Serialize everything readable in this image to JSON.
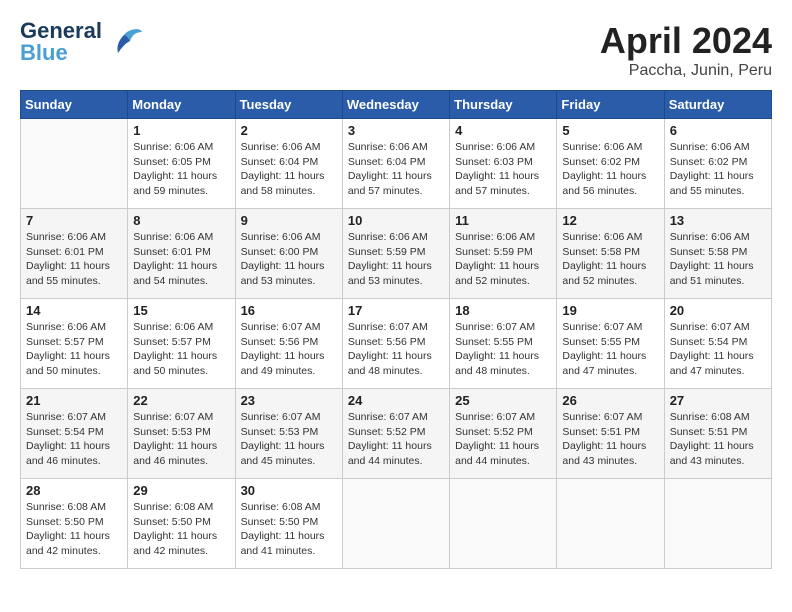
{
  "header": {
    "logo_line1": "General",
    "logo_line2": "Blue",
    "month": "April 2024",
    "location": "Paccha, Junin, Peru"
  },
  "days_of_week": [
    "Sunday",
    "Monday",
    "Tuesday",
    "Wednesday",
    "Thursday",
    "Friday",
    "Saturday"
  ],
  "weeks": [
    [
      {
        "day": "",
        "info": ""
      },
      {
        "day": "1",
        "info": "Sunrise: 6:06 AM\nSunset: 6:05 PM\nDaylight: 11 hours\nand 59 minutes."
      },
      {
        "day": "2",
        "info": "Sunrise: 6:06 AM\nSunset: 6:04 PM\nDaylight: 11 hours\nand 58 minutes."
      },
      {
        "day": "3",
        "info": "Sunrise: 6:06 AM\nSunset: 6:04 PM\nDaylight: 11 hours\nand 57 minutes."
      },
      {
        "day": "4",
        "info": "Sunrise: 6:06 AM\nSunset: 6:03 PM\nDaylight: 11 hours\nand 57 minutes."
      },
      {
        "day": "5",
        "info": "Sunrise: 6:06 AM\nSunset: 6:02 PM\nDaylight: 11 hours\nand 56 minutes."
      },
      {
        "day": "6",
        "info": "Sunrise: 6:06 AM\nSunset: 6:02 PM\nDaylight: 11 hours\nand 55 minutes."
      }
    ],
    [
      {
        "day": "7",
        "info": "Sunrise: 6:06 AM\nSunset: 6:01 PM\nDaylight: 11 hours\nand 55 minutes."
      },
      {
        "day": "8",
        "info": "Sunrise: 6:06 AM\nSunset: 6:01 PM\nDaylight: 11 hours\nand 54 minutes."
      },
      {
        "day": "9",
        "info": "Sunrise: 6:06 AM\nSunset: 6:00 PM\nDaylight: 11 hours\nand 53 minutes."
      },
      {
        "day": "10",
        "info": "Sunrise: 6:06 AM\nSunset: 5:59 PM\nDaylight: 11 hours\nand 53 minutes."
      },
      {
        "day": "11",
        "info": "Sunrise: 6:06 AM\nSunset: 5:59 PM\nDaylight: 11 hours\nand 52 minutes."
      },
      {
        "day": "12",
        "info": "Sunrise: 6:06 AM\nSunset: 5:58 PM\nDaylight: 11 hours\nand 52 minutes."
      },
      {
        "day": "13",
        "info": "Sunrise: 6:06 AM\nSunset: 5:58 PM\nDaylight: 11 hours\nand 51 minutes."
      }
    ],
    [
      {
        "day": "14",
        "info": "Sunrise: 6:06 AM\nSunset: 5:57 PM\nDaylight: 11 hours\nand 50 minutes."
      },
      {
        "day": "15",
        "info": "Sunrise: 6:06 AM\nSunset: 5:57 PM\nDaylight: 11 hours\nand 50 minutes."
      },
      {
        "day": "16",
        "info": "Sunrise: 6:07 AM\nSunset: 5:56 PM\nDaylight: 11 hours\nand 49 minutes."
      },
      {
        "day": "17",
        "info": "Sunrise: 6:07 AM\nSunset: 5:56 PM\nDaylight: 11 hours\nand 48 minutes."
      },
      {
        "day": "18",
        "info": "Sunrise: 6:07 AM\nSunset: 5:55 PM\nDaylight: 11 hours\nand 48 minutes."
      },
      {
        "day": "19",
        "info": "Sunrise: 6:07 AM\nSunset: 5:55 PM\nDaylight: 11 hours\nand 47 minutes."
      },
      {
        "day": "20",
        "info": "Sunrise: 6:07 AM\nSunset: 5:54 PM\nDaylight: 11 hours\nand 47 minutes."
      }
    ],
    [
      {
        "day": "21",
        "info": "Sunrise: 6:07 AM\nSunset: 5:54 PM\nDaylight: 11 hours\nand 46 minutes."
      },
      {
        "day": "22",
        "info": "Sunrise: 6:07 AM\nSunset: 5:53 PM\nDaylight: 11 hours\nand 46 minutes."
      },
      {
        "day": "23",
        "info": "Sunrise: 6:07 AM\nSunset: 5:53 PM\nDaylight: 11 hours\nand 45 minutes."
      },
      {
        "day": "24",
        "info": "Sunrise: 6:07 AM\nSunset: 5:52 PM\nDaylight: 11 hours\nand 44 minutes."
      },
      {
        "day": "25",
        "info": "Sunrise: 6:07 AM\nSunset: 5:52 PM\nDaylight: 11 hours\nand 44 minutes."
      },
      {
        "day": "26",
        "info": "Sunrise: 6:07 AM\nSunset: 5:51 PM\nDaylight: 11 hours\nand 43 minutes."
      },
      {
        "day": "27",
        "info": "Sunrise: 6:08 AM\nSunset: 5:51 PM\nDaylight: 11 hours\nand 43 minutes."
      }
    ],
    [
      {
        "day": "28",
        "info": "Sunrise: 6:08 AM\nSunset: 5:50 PM\nDaylight: 11 hours\nand 42 minutes."
      },
      {
        "day": "29",
        "info": "Sunrise: 6:08 AM\nSunset: 5:50 PM\nDaylight: 11 hours\nand 42 minutes."
      },
      {
        "day": "30",
        "info": "Sunrise: 6:08 AM\nSunset: 5:50 PM\nDaylight: 11 hours\nand 41 minutes."
      },
      {
        "day": "",
        "info": ""
      },
      {
        "day": "",
        "info": ""
      },
      {
        "day": "",
        "info": ""
      },
      {
        "day": "",
        "info": ""
      }
    ]
  ]
}
